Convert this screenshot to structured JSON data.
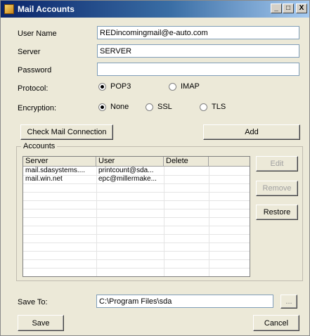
{
  "window": {
    "title": "Mail Accounts",
    "controls": {
      "minimize": "_",
      "maximize": "□",
      "close": "X"
    }
  },
  "form": {
    "user_name_label": "User Name",
    "user_name_value": "REDincomingmail@e-auto.com",
    "server_label": "Server",
    "server_value": "SERVER",
    "password_label": "Password",
    "password_value": "",
    "protocol_label": "Protocol:",
    "protocol_options": [
      "POP3",
      "IMAP"
    ],
    "protocol_selected": "POP3",
    "encryption_label": "Encryption:",
    "encryption_options": [
      "None",
      "SSL",
      "TLS"
    ],
    "encryption_selected": "None"
  },
  "buttons": {
    "check_mail": "Check Mail Connection",
    "add": "Add",
    "edit": "Edit",
    "remove": "Remove",
    "restore": "Restore",
    "browse": "...",
    "save": "Save",
    "cancel": "Cancel"
  },
  "accounts": {
    "group_label": "Accounts",
    "columns": [
      "Server",
      "User",
      "Delete"
    ],
    "rows": [
      {
        "server": "mail.sdasystems....",
        "user": "printcount@sda...",
        "delete": ""
      },
      {
        "server": "mail.win.net",
        "user": "epc@millermake...",
        "delete": ""
      }
    ]
  },
  "save_to": {
    "label": "Save To:",
    "value": "C:\\Program Files\\sda"
  }
}
